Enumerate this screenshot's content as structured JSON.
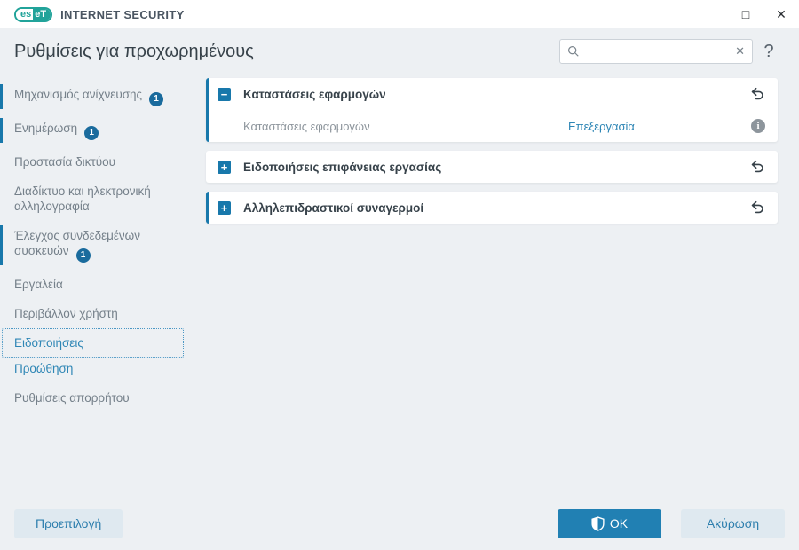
{
  "titlebar": {
    "brand_left": "es",
    "brand_right": "eT",
    "product": "INTERNET SECURITY",
    "maximize_icon": "□",
    "close_icon": "✕"
  },
  "header": {
    "title": "Ρυθμίσεις για προχωρημένους",
    "search_value": "",
    "search_clear_icon": "✕",
    "help_icon": "?"
  },
  "sidebar": {
    "items": [
      {
        "label": "Μηχανισμός ανίχνευσης",
        "badge": "1"
      },
      {
        "label": "Ενημέρωση",
        "badge": "1"
      },
      {
        "label": "Προστασία δικτύου"
      },
      {
        "label": "Διαδίκτυο και ηλεκτρονική αλληλογραφία"
      },
      {
        "label": "Έλεγχος συνδεδεμένων συσκευών",
        "badge": "1"
      },
      {
        "label": "Εργαλεία"
      },
      {
        "label": "Περιβάλλον χρήστη"
      },
      {
        "label": "Ειδοποιήσεις"
      },
      {
        "label": "Προώθηση"
      },
      {
        "label": "Ρυθμίσεις απορρήτου"
      }
    ]
  },
  "panels": [
    {
      "title": "Καταστάσεις εφαρμογών",
      "toggle_icon": "−",
      "row": {
        "label": "Καταστάσεις εφαρμογών",
        "action": "Επεξεργασία",
        "info_icon": "i"
      }
    },
    {
      "title": "Ειδοποιήσεις επιφάνειας εργασίας",
      "toggle_icon": "+"
    },
    {
      "title": "Αλληλεπιδραστικοί συναγερμοί",
      "toggle_icon": "+"
    }
  ],
  "footer": {
    "default_label": "Προεπιλογή",
    "ok_label": "OK",
    "cancel_label": "Ακύρωση"
  },
  "colors": {
    "accent": "#2180b3",
    "modified_bar": "#1878ab",
    "link": "#2e86b5",
    "badge": "#1a6b9d",
    "brand_teal": "#21a39a"
  }
}
